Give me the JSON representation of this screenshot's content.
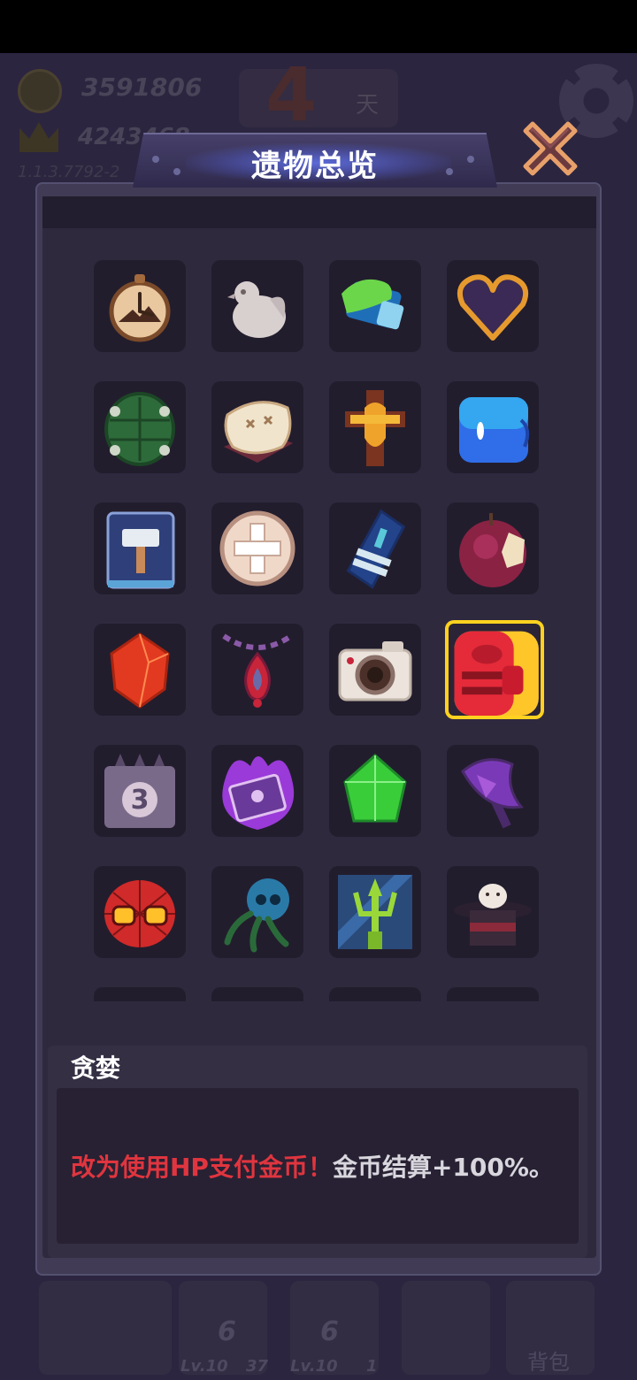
{
  "hud": {
    "coins": "3591806",
    "crowns": "4243468",
    "version": "1.1.3.7792-2",
    "day_number": "4",
    "day_unit": "天",
    "bottom_cards": [
      {
        "num": "6",
        "level": "Lv.10",
        "count": "37"
      },
      {
        "num": "6",
        "level": "Lv.10",
        "count": "1"
      }
    ],
    "bag_label": "背包"
  },
  "modal": {
    "title": "遗物总览",
    "relics": [
      {
        "icon": "pocket-watch-icon"
      },
      {
        "icon": "stone-chicken-icon"
      },
      {
        "icon": "slime-scroll-icon"
      },
      {
        "icon": "heart-frame-icon"
      },
      {
        "icon": "turtle-shell-icon"
      },
      {
        "icon": "pillow-icon"
      },
      {
        "icon": "golden-cross-icon"
      },
      {
        "icon": "blue-slime-cube-icon"
      },
      {
        "icon": "hammer-book-icon"
      },
      {
        "icon": "holy-cross-shield-icon"
      },
      {
        "icon": "blue-coffin-icon"
      },
      {
        "icon": "bitten-apple-icon"
      },
      {
        "icon": "red-gem-icon"
      },
      {
        "icon": "flame-amulet-icon"
      },
      {
        "icon": "camera-icon"
      },
      {
        "icon": "greed-mimic-icon",
        "selected": true
      },
      {
        "icon": "skull-calendar-icon"
      },
      {
        "icon": "cursed-book-icon"
      },
      {
        "icon": "green-gem-icon"
      },
      {
        "icon": "purple-axe-icon"
      },
      {
        "icon": "spider-mask-icon"
      },
      {
        "icon": "octopus-skull-icon"
      },
      {
        "icon": "green-trident-icon"
      },
      {
        "icon": "magic-hat-icon"
      }
    ],
    "selected": {
      "name": "贪婪",
      "effect_highlight": "改为使用HP支付金币！",
      "effect_rest": "金币结算+100%。"
    }
  },
  "colors": {
    "selected_border": "#ffd21f",
    "highlight_text": "#e0353f"
  }
}
